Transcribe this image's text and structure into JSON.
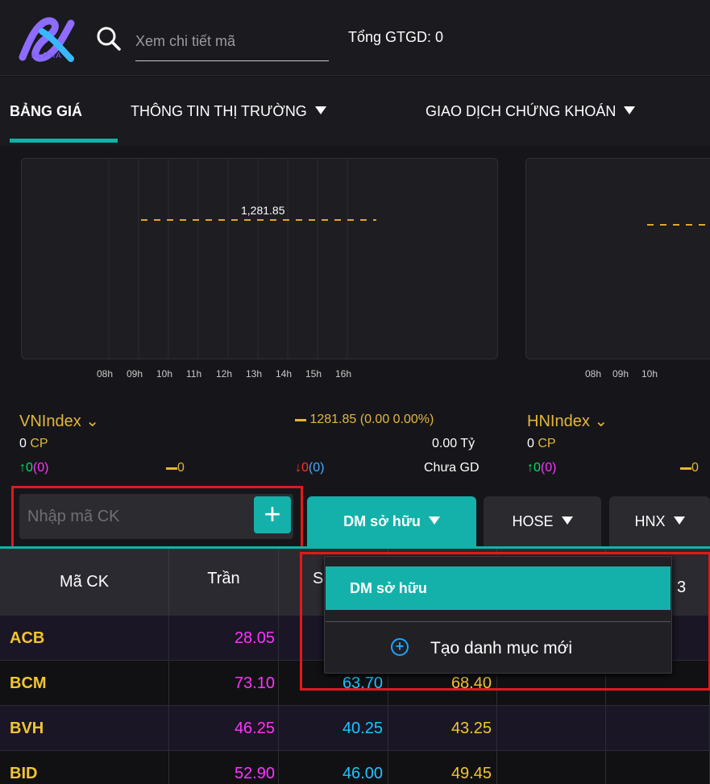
{
  "header": {
    "logo_text": "ALPHA",
    "search_placeholder": "Xem chi tiết mã",
    "total_label": "Tổng GTGD: 0"
  },
  "nav": {
    "items": [
      "BẢNG GIÁ",
      "THÔNG TIN THỊ TRƯỜNG",
      "GIAO DỊCH CHỨNG KHOÁN"
    ]
  },
  "charts": {
    "chart1_value_label": "1,281.85",
    "chart1_ticks": [
      "08h",
      "09h",
      "10h",
      "11h",
      "12h",
      "13h",
      "14h",
      "15h",
      "16h"
    ],
    "chart2_ticks": [
      "08h",
      "09h",
      "10h"
    ]
  },
  "chart_data": [
    {
      "type": "line",
      "title": "",
      "x": [
        "08h",
        "09h",
        "10h",
        "11h",
        "12h",
        "13h",
        "14h",
        "15h",
        "16h"
      ],
      "reference": 1281.85,
      "series": []
    },
    {
      "type": "line",
      "title": "",
      "x": [
        "08h",
        "09h",
        "10h"
      ],
      "series": []
    }
  ],
  "indices": {
    "vn": {
      "name": "VNIndex",
      "value": "1281.85",
      "change": "(0.00 0.00%)",
      "cp": "0",
      "cp_unit": "CP",
      "value_traded": "0.00",
      "value_unit": "Tỷ",
      "up": "0",
      "up_ceiling": "(0)",
      "flat": "0",
      "down": "0",
      "down_floor": "(0)",
      "status": "Chưa GD"
    },
    "hn": {
      "name": "HNIndex",
      "cp": "0",
      "cp_unit": "CP",
      "up": "0",
      "up_ceiling": "(0)",
      "flat": "0"
    }
  },
  "watchlist": {
    "code_placeholder": "Nhập mã CK",
    "tabs": [
      "DM sở hữu",
      "HOSE",
      "HNX"
    ],
    "dropdown": {
      "selected": "DM sở hữu",
      "create_new": "Tạo danh mục mới"
    }
  },
  "table": {
    "headers": [
      "Mã CK",
      "Trần",
      "S",
      "",
      "",
      "3"
    ],
    "rows": [
      {
        "symbol": "ACB",
        "tran": "28.05",
        "san": "",
        "tc": ""
      },
      {
        "symbol": "BCM",
        "tran": "73.10",
        "san": "63.70",
        "tc": "68.40"
      },
      {
        "symbol": "BVH",
        "tran": "46.25",
        "san": "40.25",
        "tc": "43.25"
      },
      {
        "symbol": "BID",
        "tran": "52.90",
        "san": "46.00",
        "tc": "49.45"
      }
    ]
  },
  "colors": {
    "accent": "#14b1aa",
    "highlight_box": "#e01a1a",
    "ceiling": "#ff33ff",
    "floor": "#19c7ff",
    "reference": "#f2c531"
  }
}
